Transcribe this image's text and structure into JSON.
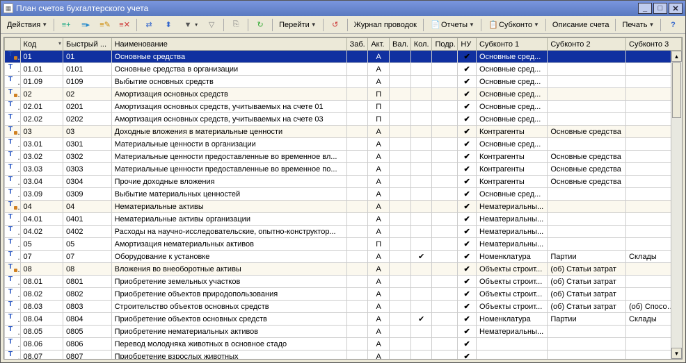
{
  "window": {
    "title": "План счетов бухгалтерского учета"
  },
  "toolbar": {
    "actions": "Действия",
    "goto": "Перейти",
    "journal": "Журнал проводок",
    "reports": "Отчеты",
    "subconto": "Субконто",
    "desc": "Описание счета",
    "print": "Печать"
  },
  "columns": {
    "c0": "",
    "c_code": "Код",
    "c_fast": "Быстрый ...",
    "c_name": "Наименование",
    "c_zab": "Заб.",
    "c_act": "Акт.",
    "c_val": "Вал.",
    "c_kol": "Кол.",
    "c_podr": "Подр.",
    "c_nu": "НУ",
    "c_s1": "Субконто 1",
    "c_s2": "Субконто 2",
    "c_s3": "Субконто 3"
  },
  "marks": {
    "check": "✔"
  },
  "rows": [
    {
      "sel": true,
      "sub": true,
      "code": "01",
      "fast": "01",
      "name": "Основные средства",
      "act": "А",
      "kol": "",
      "nu": true,
      "s1": "Основные сред...",
      "s2": "",
      "s3": ""
    },
    {
      "sub": false,
      "code": "01.01",
      "fast": "0101",
      "name": "Основные средства в организации",
      "act": "А",
      "kol": "",
      "nu": true,
      "s1": "Основные сред...",
      "s2": "",
      "s3": ""
    },
    {
      "sub": false,
      "code": "01.09",
      "fast": "0109",
      "name": "Выбытие основных средств",
      "act": "А",
      "kol": "",
      "nu": true,
      "s1": "Основные сред...",
      "s2": "",
      "s3": ""
    },
    {
      "sub": true,
      "code": "02",
      "fast": "02",
      "name": "Амортизация основных средств",
      "act": "П",
      "kol": "",
      "nu": true,
      "s1": "Основные сред...",
      "s2": "",
      "s3": ""
    },
    {
      "sub": false,
      "code": "02.01",
      "fast": "0201",
      "name": "Амортизация основных средств, учитываемых на счете 01",
      "act": "П",
      "kol": "",
      "nu": true,
      "s1": "Основные сред...",
      "s2": "",
      "s3": ""
    },
    {
      "sub": false,
      "code": "02.02",
      "fast": "0202",
      "name": "Амортизация основных средств, учитываемых на счете 03",
      "act": "П",
      "kol": "",
      "nu": true,
      "s1": "Основные сред...",
      "s2": "",
      "s3": ""
    },
    {
      "sub": true,
      "code": "03",
      "fast": "03",
      "name": "Доходные вложения в материальные ценности",
      "act": "А",
      "kol": "",
      "nu": true,
      "s1": "Контрагенты",
      "s2": "Основные средства",
      "s3": ""
    },
    {
      "sub": false,
      "code": "03.01",
      "fast": "0301",
      "name": "Материальные ценности в организации",
      "act": "А",
      "kol": "",
      "nu": true,
      "s1": "Основные сред...",
      "s2": "",
      "s3": ""
    },
    {
      "sub": false,
      "code": "03.02",
      "fast": "0302",
      "name": "Материальные ценности предоставленные во временное вл...",
      "act": "А",
      "kol": "",
      "nu": true,
      "s1": "Контрагенты",
      "s2": "Основные средства",
      "s3": ""
    },
    {
      "sub": false,
      "code": "03.03",
      "fast": "0303",
      "name": "Материальные ценности предоставленные во временное по...",
      "act": "А",
      "kol": "",
      "nu": true,
      "s1": "Контрагенты",
      "s2": "Основные средства",
      "s3": ""
    },
    {
      "sub": false,
      "code": "03.04",
      "fast": "0304",
      "name": "Прочие доходные вложения",
      "act": "А",
      "kol": "",
      "nu": true,
      "s1": "Контрагенты",
      "s2": "Основные средства",
      "s3": ""
    },
    {
      "sub": false,
      "code": "03.09",
      "fast": "0309",
      "name": "Выбытие материальных ценностей",
      "act": "А",
      "kol": "",
      "nu": true,
      "s1": "Основные сред...",
      "s2": "",
      "s3": ""
    },
    {
      "sub": true,
      "code": "04",
      "fast": "04",
      "name": "Нематериальные активы",
      "act": "А",
      "kol": "",
      "nu": true,
      "s1": "Нематериальны...",
      "s2": "",
      "s3": ""
    },
    {
      "sub": false,
      "code": "04.01",
      "fast": "0401",
      "name": "Нематериальные активы организации",
      "act": "А",
      "kol": "",
      "nu": true,
      "s1": "Нематериальны...",
      "s2": "",
      "s3": ""
    },
    {
      "sub": false,
      "code": "04.02",
      "fast": "0402",
      "name": "Расходы на научно-исследовательские, опытно-конструктор...",
      "act": "А",
      "kol": "",
      "nu": true,
      "s1": "Нематериальны...",
      "s2": "",
      "s3": ""
    },
    {
      "sub": false,
      "code": "05",
      "fast": "05",
      "name": "Амортизация нематериальных активов",
      "act": "П",
      "kol": "",
      "nu": true,
      "s1": "Нематериальны...",
      "s2": "",
      "s3": ""
    },
    {
      "sub": false,
      "code": "07",
      "fast": "07",
      "name": "Оборудование к установке",
      "act": "А",
      "kol": "✔",
      "nu": true,
      "s1": "Номенклатура",
      "s2": "Партии",
      "s3": "Склады"
    },
    {
      "sub": true,
      "code": "08",
      "fast": "08",
      "name": "Вложения во внеоборотные активы",
      "act": "А",
      "kol": "",
      "nu": true,
      "s1": "Объекты строит...",
      "s2": "(об) Статьи затрат",
      "s3": ""
    },
    {
      "sub": false,
      "code": "08.01",
      "fast": "0801",
      "name": "Приобретение земельных участков",
      "act": "А",
      "kol": "",
      "nu": true,
      "s1": "Объекты строит...",
      "s2": "(об) Статьи затрат",
      "s3": ""
    },
    {
      "sub": false,
      "code": "08.02",
      "fast": "0802",
      "name": "Приобретение объектов природопользования",
      "act": "А",
      "kol": "",
      "nu": true,
      "s1": "Объекты строит...",
      "s2": "(об) Статьи затрат",
      "s3": ""
    },
    {
      "sub": false,
      "code": "08.03",
      "fast": "0803",
      "name": "Строительство объектов основных средств",
      "act": "А",
      "kol": "",
      "nu": true,
      "s1": "Объекты строит...",
      "s2": "(об) Статьи затрат",
      "s3": "(об) Способо..."
    },
    {
      "sub": false,
      "code": "08.04",
      "fast": "0804",
      "name": "Приобретение объектов основных средств",
      "act": "А",
      "kol": "✔",
      "nu": true,
      "s1": "Номенклатура",
      "s2": "Партии",
      "s3": "Склады"
    },
    {
      "sub": false,
      "code": "08.05",
      "fast": "0805",
      "name": "Приобретение нематериальных активов",
      "act": "А",
      "kol": "",
      "nu": true,
      "s1": "Нематериальны...",
      "s2": "",
      "s3": ""
    },
    {
      "sub": false,
      "code": "08.06",
      "fast": "0806",
      "name": "Перевод молодняка животных в основное стадо",
      "act": "А",
      "kol": "",
      "nu": true,
      "s1": "",
      "s2": "",
      "s3": ""
    },
    {
      "sub": false,
      "code": "08.07",
      "fast": "0807",
      "name": "Приобретение взрослых животных",
      "act": "А",
      "kol": "",
      "nu": true,
      "s1": "",
      "s2": "",
      "s3": ""
    }
  ]
}
